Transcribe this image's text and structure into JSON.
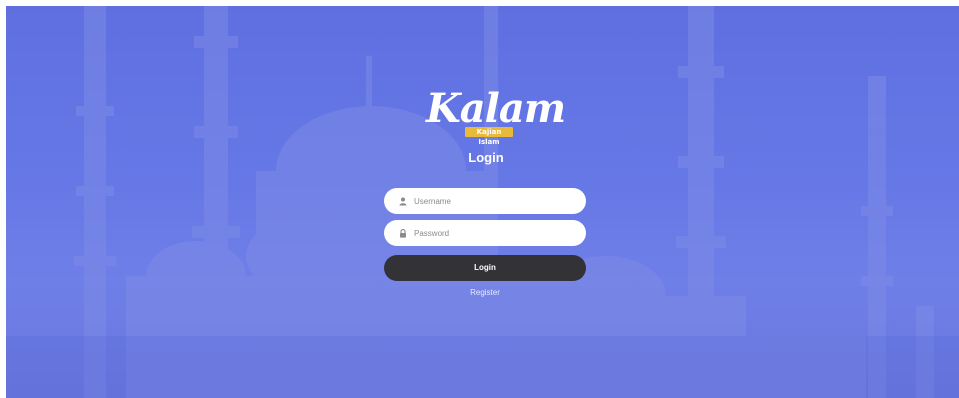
{
  "brand": {
    "logo_text": "Kalam",
    "tagline": "Kajian Islam",
    "badge_color": "#e9b93a"
  },
  "login": {
    "title": "Login",
    "username_placeholder": "Username",
    "password_placeholder": "Password",
    "submit_label": "Login",
    "register_label": "Register"
  },
  "theme": {
    "background_tint": "#6272e3",
    "button_color": "#333236"
  },
  "icons": {
    "username": "user-icon",
    "password": "lock-icon"
  }
}
